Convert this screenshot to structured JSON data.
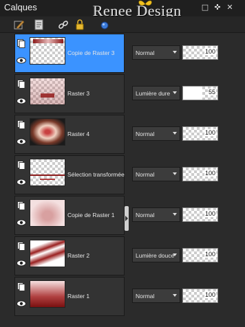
{
  "window": {
    "title": "Calques",
    "watermark": "Renee Design",
    "buttons": [
      "restore",
      "dock",
      "close"
    ]
  },
  "toolbar": {
    "tools": [
      "edit-layer-icon",
      "properties-icon",
      "link-icon",
      "lock-icon",
      "globe-icon"
    ]
  },
  "layers": [
    {
      "name": "Copie de Raster 3",
      "blend": "Normal",
      "opacity": "100",
      "opacity_fraction": 1.0,
      "selected": true,
      "thumb": "strip"
    },
    {
      "name": "Raster 3",
      "blend": "Lumière dure",
      "opacity": "55",
      "opacity_fraction": 0.55,
      "selected": false,
      "thumb": "bar"
    },
    {
      "name": "Raster 4",
      "blend": "Normal",
      "opacity": "100",
      "opacity_fraction": 1.0,
      "selected": false,
      "thumb": "flower"
    },
    {
      "name": "Sélection transformée",
      "blend": "Normal",
      "opacity": "100",
      "opacity_fraction": 1.0,
      "selected": false,
      "thumb": "lines"
    },
    {
      "name": "Copie de Raster 1",
      "blend": "Normal",
      "opacity": "100",
      "opacity_fraction": 1.0,
      "selected": false,
      "thumb": "pattern"
    },
    {
      "name": "Raster 2",
      "blend": "Lumière douce",
      "opacity": "100",
      "opacity_fraction": 1.0,
      "selected": false,
      "thumb": "waves"
    },
    {
      "name": "Raster 1",
      "blend": "Normal",
      "opacity": "100",
      "opacity_fraction": 1.0,
      "selected": false,
      "thumb": "gradient"
    }
  ],
  "colors": {
    "selected": "#3b93ff",
    "panel": "#2b2b2b",
    "accent_red": "#8b1a1a"
  }
}
